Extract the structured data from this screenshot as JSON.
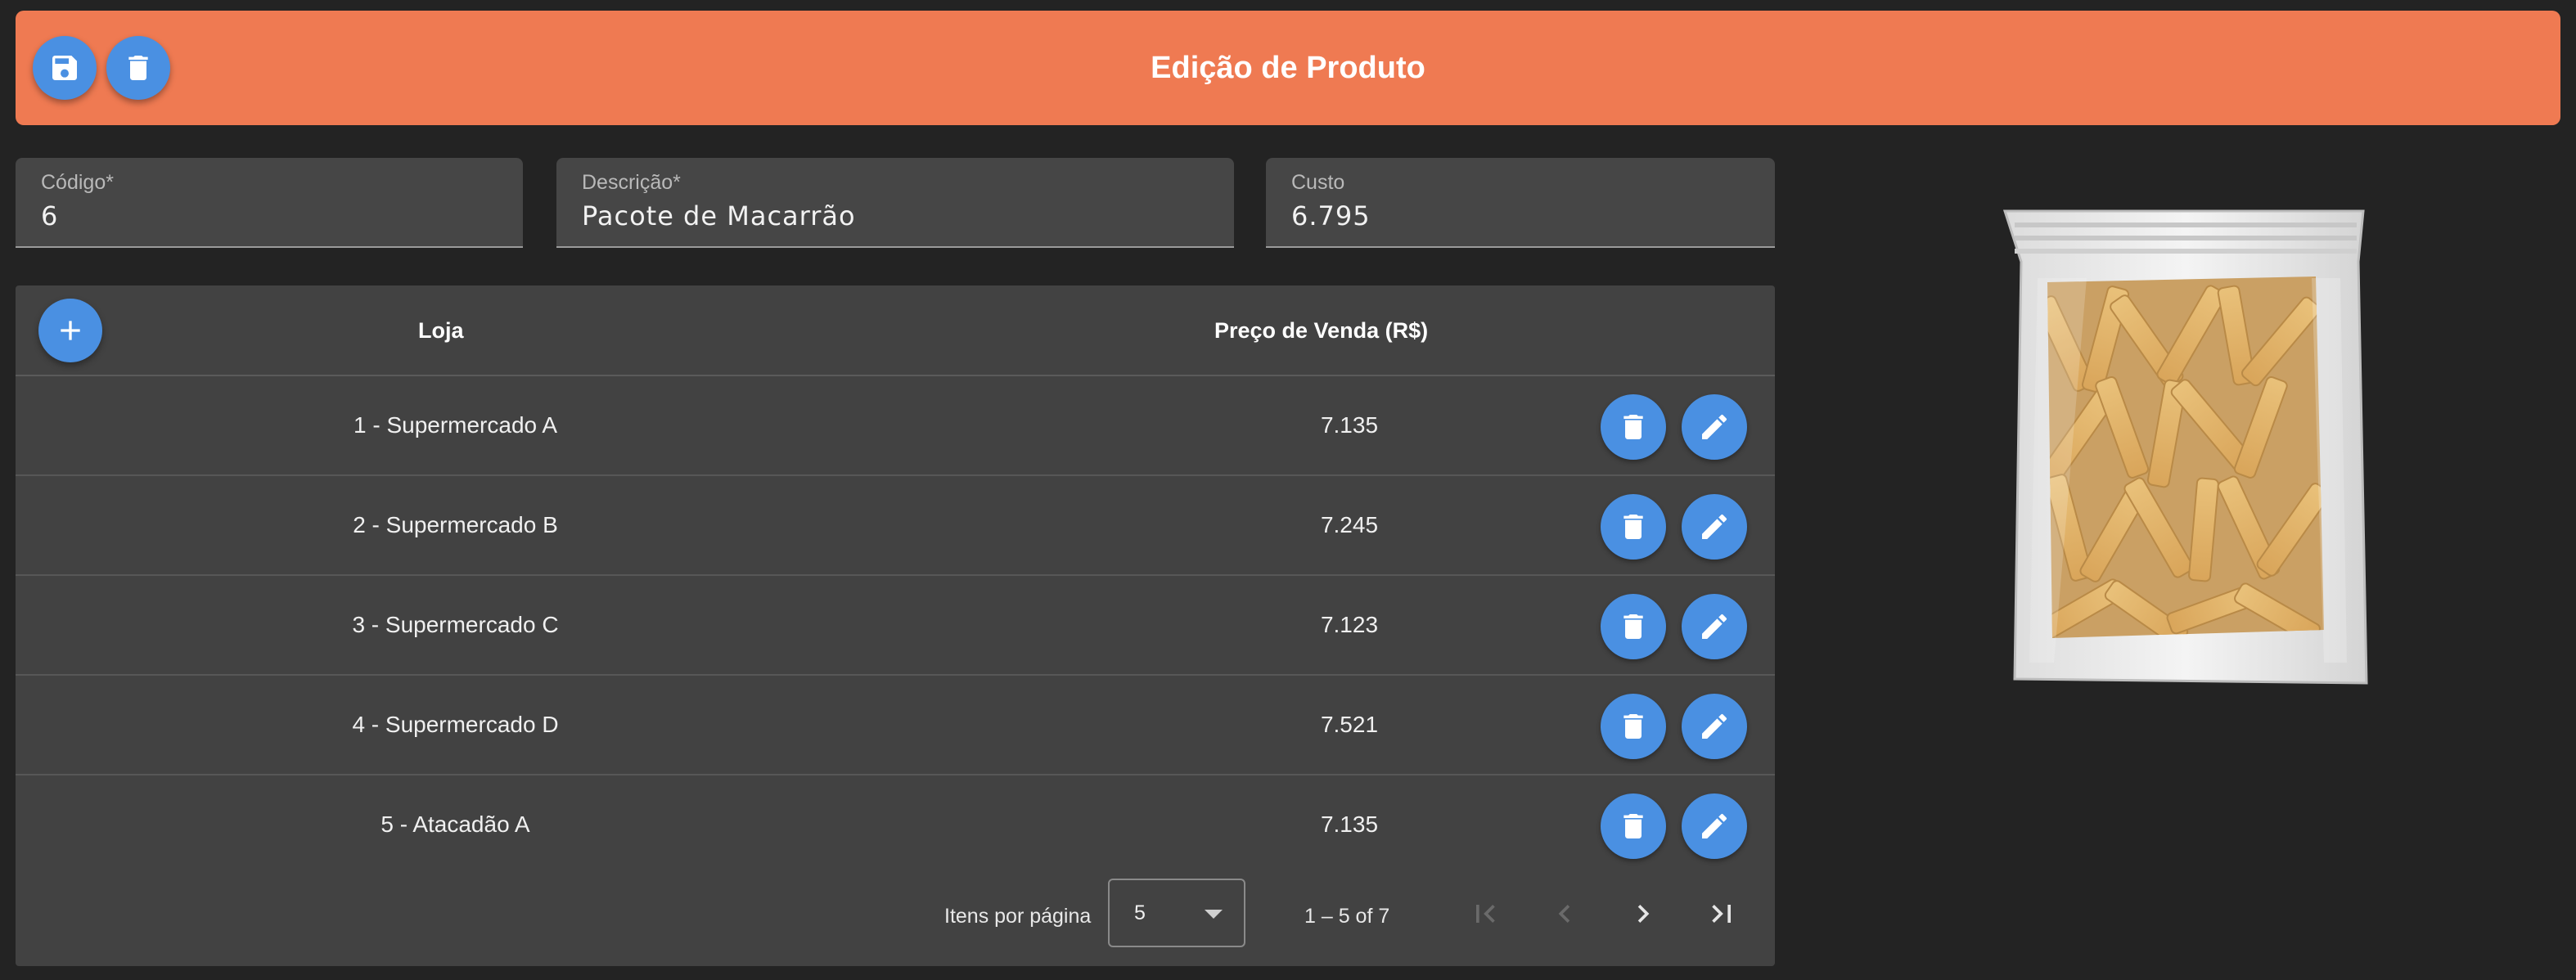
{
  "header": {
    "title": "Edição de Produto",
    "save_icon": "floppy-disk-icon",
    "delete_icon": "trash-icon"
  },
  "form": {
    "codigo": {
      "label": "Código*",
      "value": "6"
    },
    "descricao": {
      "label": "Descrição*",
      "value": "Pacote de Macarrão"
    },
    "custo": {
      "label": "Custo",
      "value": "6.795"
    }
  },
  "table": {
    "add_icon": "plus-icon",
    "columns": [
      "Loja",
      "Preço de Venda (R$)"
    ],
    "rows": [
      {
        "store": "1 - Supermercado A",
        "price": "7.135"
      },
      {
        "store": "2 - Supermercado B",
        "price": "7.245"
      },
      {
        "store": "3 - Supermercado C",
        "price": "7.123"
      },
      {
        "store": "4 - Supermercado D",
        "price": "7.521"
      },
      {
        "store": "5 - Atacadão A",
        "price": "7.135"
      }
    ],
    "row_action_icons": [
      "trash-icon",
      "pencil-icon"
    ]
  },
  "paginator": {
    "items_per_page_label": "Itens por página",
    "items_per_page_value": "5",
    "range_label": "1 – 5 of 7",
    "first_page_icon": "first-page-icon",
    "prev_page_icon": "chevron-left-icon",
    "next_page_icon": "chevron-right-icon",
    "last_page_icon": "last-page-icon"
  },
  "colors": {
    "header_bg": "#ef7a52",
    "accent_button": "#4a90e2",
    "page_bg": "#232323",
    "card_bg": "#424242",
    "field_bg": "#464646"
  },
  "product_image": {
    "subject": "bag of penne pasta"
  }
}
